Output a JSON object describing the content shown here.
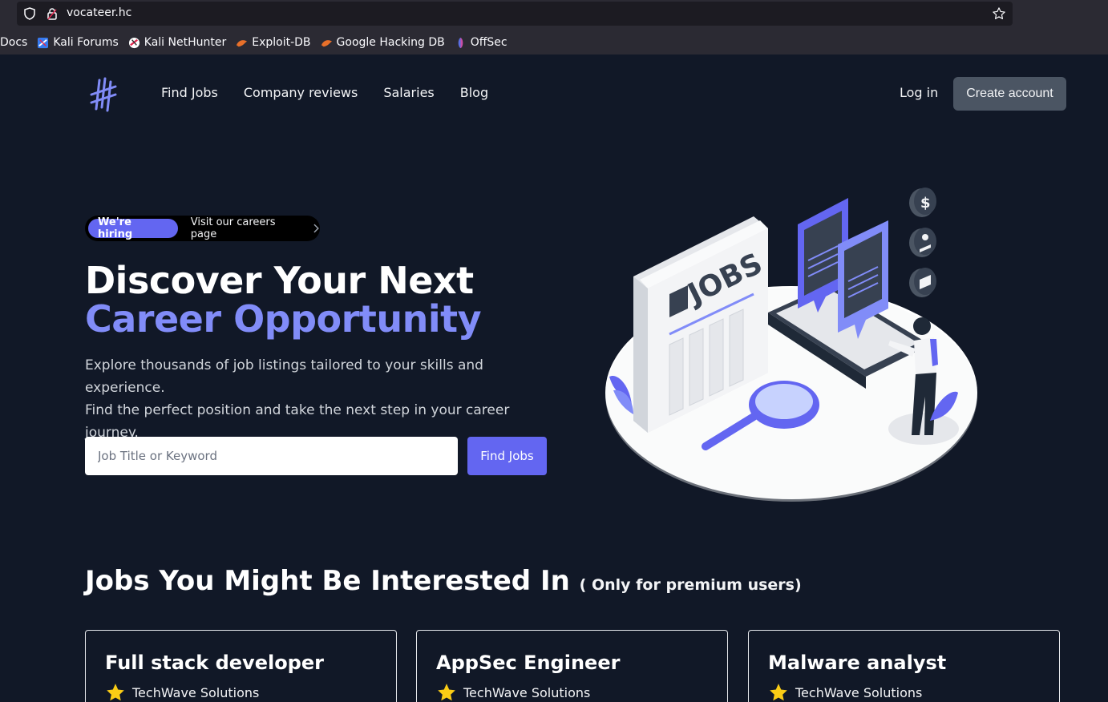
{
  "browser": {
    "url": "vocateer.hc",
    "bookmarks": [
      {
        "label": "Docs",
        "icon": "none"
      },
      {
        "label": "Kali Forums",
        "icon": "kali-forums-icon"
      },
      {
        "label": "Kali NetHunter",
        "icon": "kali-nethunter-icon"
      },
      {
        "label": "Exploit-DB",
        "icon": "exploit-db-icon"
      },
      {
        "label": "Google Hacking DB",
        "icon": "ghdb-icon"
      },
      {
        "label": "OffSec",
        "icon": "offsec-icon"
      }
    ]
  },
  "nav": {
    "links": [
      "Find Jobs",
      "Company reviews",
      "Salaries",
      "Blog"
    ],
    "login": "Log in",
    "create_account": "Create account"
  },
  "hero": {
    "badge": "We're hiring",
    "badge_link": "Visit our careers page",
    "title_line1": "Discover Your Next",
    "title_line2": "Career Opportunity",
    "lead_line1": "Explore thousands of job listings tailored to your skills and experience.",
    "lead_line2": "Find the perfect position and take the next step in your career journey.",
    "search_placeholder": "Job Title or Keyword",
    "search_button": "Find Jobs",
    "illustration_text": "JOBS"
  },
  "jobs_section": {
    "title": "Jobs You Might Be Interested In",
    "subtitle": "( Only for premium users)",
    "cards": [
      {
        "title": "Full stack developer",
        "company": "TechWave Solutions"
      },
      {
        "title": "AppSec Engineer",
        "company": "TechWave Solutions"
      },
      {
        "title": "Malware analyst",
        "company": "TechWave Solutions"
      }
    ]
  },
  "colors": {
    "background": "#111827",
    "accent": "#6366f1",
    "accent_light": "#818cf8",
    "star": "#facc15"
  }
}
